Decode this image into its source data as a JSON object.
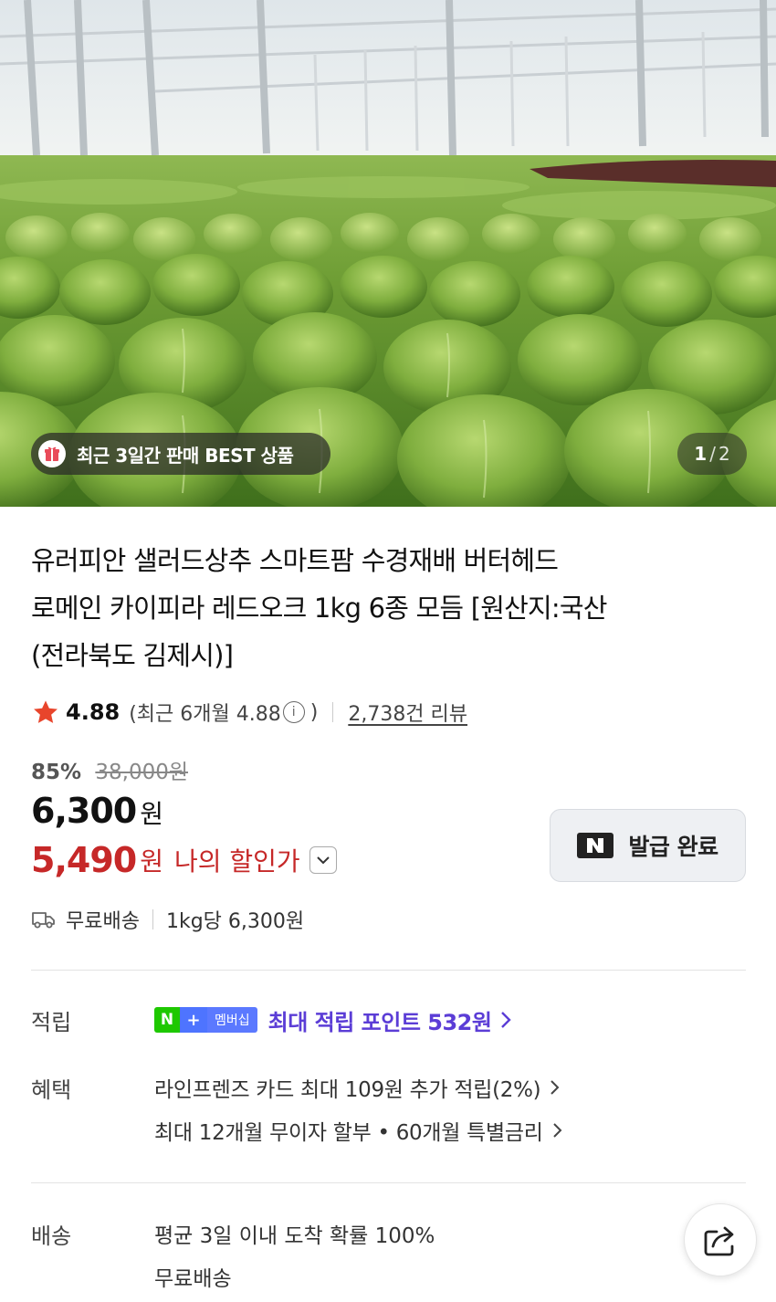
{
  "hero": {
    "badge_text": "최근 3일간 판매 BEST 상품",
    "pager_current": "1",
    "pager_separator": "/",
    "pager_total": "2"
  },
  "product": {
    "title_line1": "유러피안 샐러드상추 스마트팜 수경재배 버터헤드",
    "title_line2": "로메인 카이피라 레드오크 1kg 6종 모듬 [원산지:국산",
    "title_line3": "(전라북도 김제시)]"
  },
  "rating": {
    "score": "4.88",
    "recent_text": "(최근 6개월 4.88",
    "recent_close": ")",
    "review_count": "2,738건 리뷰"
  },
  "price": {
    "discount_pct": "85%",
    "original": "38,000원",
    "sale": "6,300",
    "sale_unit": "원",
    "my_price": "5,490",
    "my_unit": "원",
    "my_label": "나의 할인가"
  },
  "coupon": {
    "label": "발급 완료"
  },
  "shipping": {
    "free": "무료배송",
    "per_unit": "1kg당 6,300원"
  },
  "points": {
    "label": "적립",
    "badge_n": "N",
    "badge_plus": "+",
    "badge_member": "멤버십",
    "text": "최대 적립 포인트 532원"
  },
  "benefits": {
    "label": "혜택",
    "line1": "라인프렌즈 카드 최대 109원 추가 적립(2%)",
    "line2": "최대 12개월 무이자 할부 • 60개월 특별금리"
  },
  "delivery": {
    "label": "배송",
    "line1": "평균 3일 이내 도착 확률 100%",
    "line2": "무료배송"
  },
  "colors": {
    "star": "#e8452c",
    "discount_red": "#c62828",
    "points_purple": "#5b3dd6",
    "naver_green": "#1ec800"
  }
}
